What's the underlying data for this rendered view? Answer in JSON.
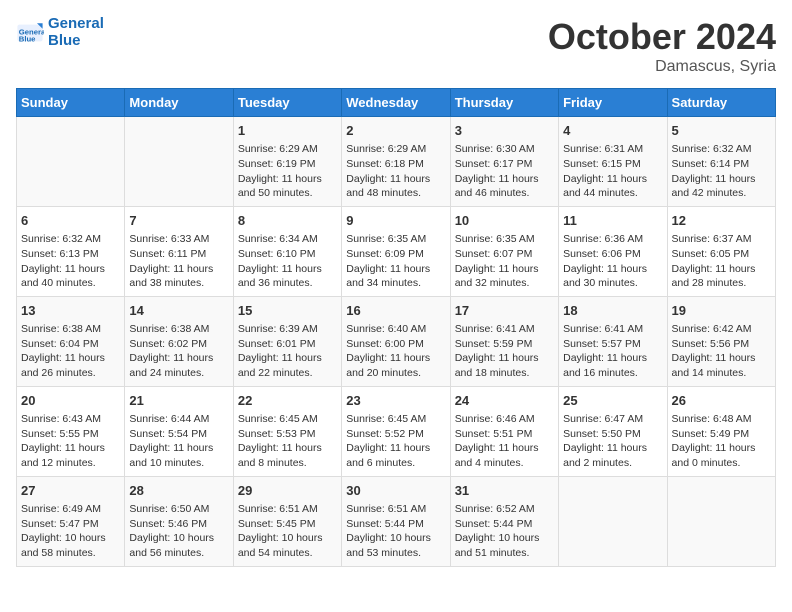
{
  "logo": {
    "line1": "General",
    "line2": "Blue"
  },
  "header": {
    "month": "October 2024",
    "location": "Damascus, Syria"
  },
  "weekdays": [
    "Sunday",
    "Monday",
    "Tuesday",
    "Wednesday",
    "Thursday",
    "Friday",
    "Saturday"
  ],
  "weeks": [
    [
      {
        "day": "",
        "info": ""
      },
      {
        "day": "",
        "info": ""
      },
      {
        "day": "1",
        "info": "Sunrise: 6:29 AM\nSunset: 6:19 PM\nDaylight: 11 hours and 50 minutes."
      },
      {
        "day": "2",
        "info": "Sunrise: 6:29 AM\nSunset: 6:18 PM\nDaylight: 11 hours and 48 minutes."
      },
      {
        "day": "3",
        "info": "Sunrise: 6:30 AM\nSunset: 6:17 PM\nDaylight: 11 hours and 46 minutes."
      },
      {
        "day": "4",
        "info": "Sunrise: 6:31 AM\nSunset: 6:15 PM\nDaylight: 11 hours and 44 minutes."
      },
      {
        "day": "5",
        "info": "Sunrise: 6:32 AM\nSunset: 6:14 PM\nDaylight: 11 hours and 42 minutes."
      }
    ],
    [
      {
        "day": "6",
        "info": "Sunrise: 6:32 AM\nSunset: 6:13 PM\nDaylight: 11 hours and 40 minutes."
      },
      {
        "day": "7",
        "info": "Sunrise: 6:33 AM\nSunset: 6:11 PM\nDaylight: 11 hours and 38 minutes."
      },
      {
        "day": "8",
        "info": "Sunrise: 6:34 AM\nSunset: 6:10 PM\nDaylight: 11 hours and 36 minutes."
      },
      {
        "day": "9",
        "info": "Sunrise: 6:35 AM\nSunset: 6:09 PM\nDaylight: 11 hours and 34 minutes."
      },
      {
        "day": "10",
        "info": "Sunrise: 6:35 AM\nSunset: 6:07 PM\nDaylight: 11 hours and 32 minutes."
      },
      {
        "day": "11",
        "info": "Sunrise: 6:36 AM\nSunset: 6:06 PM\nDaylight: 11 hours and 30 minutes."
      },
      {
        "day": "12",
        "info": "Sunrise: 6:37 AM\nSunset: 6:05 PM\nDaylight: 11 hours and 28 minutes."
      }
    ],
    [
      {
        "day": "13",
        "info": "Sunrise: 6:38 AM\nSunset: 6:04 PM\nDaylight: 11 hours and 26 minutes."
      },
      {
        "day": "14",
        "info": "Sunrise: 6:38 AM\nSunset: 6:02 PM\nDaylight: 11 hours and 24 minutes."
      },
      {
        "day": "15",
        "info": "Sunrise: 6:39 AM\nSunset: 6:01 PM\nDaylight: 11 hours and 22 minutes."
      },
      {
        "day": "16",
        "info": "Sunrise: 6:40 AM\nSunset: 6:00 PM\nDaylight: 11 hours and 20 minutes."
      },
      {
        "day": "17",
        "info": "Sunrise: 6:41 AM\nSunset: 5:59 PM\nDaylight: 11 hours and 18 minutes."
      },
      {
        "day": "18",
        "info": "Sunrise: 6:41 AM\nSunset: 5:57 PM\nDaylight: 11 hours and 16 minutes."
      },
      {
        "day": "19",
        "info": "Sunrise: 6:42 AM\nSunset: 5:56 PM\nDaylight: 11 hours and 14 minutes."
      }
    ],
    [
      {
        "day": "20",
        "info": "Sunrise: 6:43 AM\nSunset: 5:55 PM\nDaylight: 11 hours and 12 minutes."
      },
      {
        "day": "21",
        "info": "Sunrise: 6:44 AM\nSunset: 5:54 PM\nDaylight: 11 hours and 10 minutes."
      },
      {
        "day": "22",
        "info": "Sunrise: 6:45 AM\nSunset: 5:53 PM\nDaylight: 11 hours and 8 minutes."
      },
      {
        "day": "23",
        "info": "Sunrise: 6:45 AM\nSunset: 5:52 PM\nDaylight: 11 hours and 6 minutes."
      },
      {
        "day": "24",
        "info": "Sunrise: 6:46 AM\nSunset: 5:51 PM\nDaylight: 11 hours and 4 minutes."
      },
      {
        "day": "25",
        "info": "Sunrise: 6:47 AM\nSunset: 5:50 PM\nDaylight: 11 hours and 2 minutes."
      },
      {
        "day": "26",
        "info": "Sunrise: 6:48 AM\nSunset: 5:49 PM\nDaylight: 11 hours and 0 minutes."
      }
    ],
    [
      {
        "day": "27",
        "info": "Sunrise: 6:49 AM\nSunset: 5:47 PM\nDaylight: 10 hours and 58 minutes."
      },
      {
        "day": "28",
        "info": "Sunrise: 6:50 AM\nSunset: 5:46 PM\nDaylight: 10 hours and 56 minutes."
      },
      {
        "day": "29",
        "info": "Sunrise: 6:51 AM\nSunset: 5:45 PM\nDaylight: 10 hours and 54 minutes."
      },
      {
        "day": "30",
        "info": "Sunrise: 6:51 AM\nSunset: 5:44 PM\nDaylight: 10 hours and 53 minutes."
      },
      {
        "day": "31",
        "info": "Sunrise: 6:52 AM\nSunset: 5:44 PM\nDaylight: 10 hours and 51 minutes."
      },
      {
        "day": "",
        "info": ""
      },
      {
        "day": "",
        "info": ""
      }
    ]
  ]
}
